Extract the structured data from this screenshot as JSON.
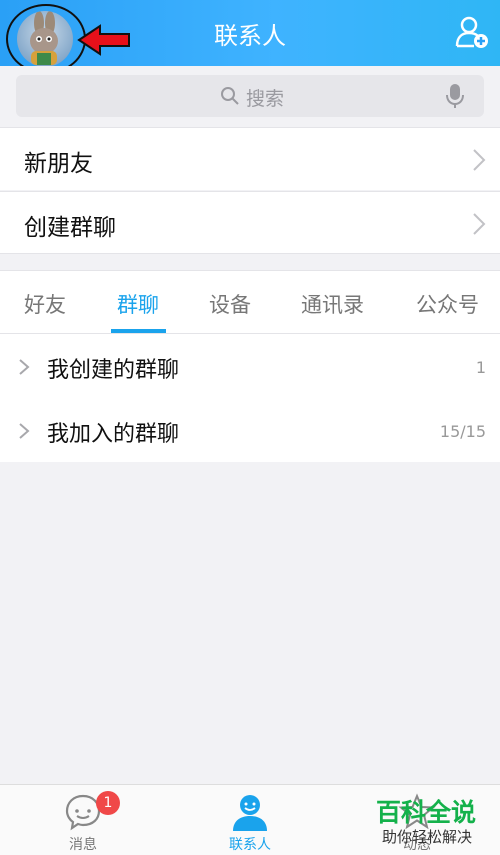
{
  "header": {
    "title": "联系人"
  },
  "search": {
    "placeholder": "搜索"
  },
  "menu": [
    {
      "label": "新朋友"
    },
    {
      "label": "创建群聊"
    }
  ],
  "tabs": [
    {
      "label": "好友"
    },
    {
      "label": "群聊",
      "active": true
    },
    {
      "label": "设备"
    },
    {
      "label": "通讯录"
    },
    {
      "label": "公众号"
    }
  ],
  "groups": [
    {
      "label": "我创建的群聊",
      "count": "1"
    },
    {
      "label": "我加入的群聊",
      "count": "15/15"
    }
  ],
  "bottom_nav": [
    {
      "label": "消息",
      "badge": "1",
      "icon": "message-icon"
    },
    {
      "label": "联系人",
      "active": true,
      "icon": "contacts-icon"
    },
    {
      "label": "动态",
      "icon": "star-icon"
    }
  ],
  "watermark": {
    "title": "百科全说",
    "subtitle": "助你轻松解决"
  },
  "colors": {
    "accent": "#1aa3ec",
    "header": "#2aa0f6",
    "badge": "#f04848",
    "watermark": "#14b14b",
    "annotation": "#e8101a"
  }
}
